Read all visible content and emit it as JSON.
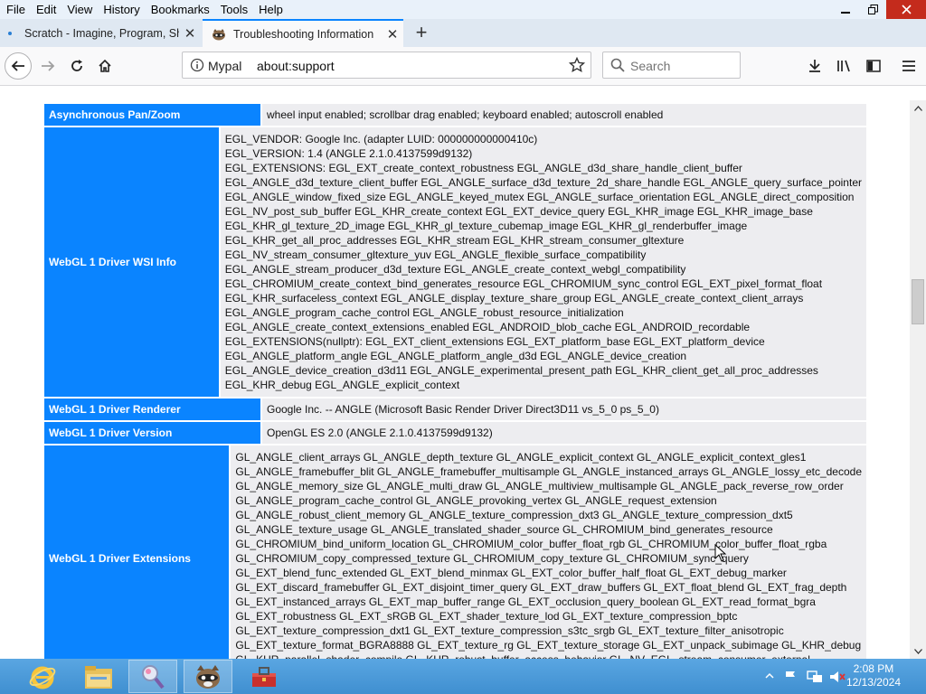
{
  "menu": [
    "File",
    "Edit",
    "View",
    "History",
    "Bookmarks",
    "Tools",
    "Help"
  ],
  "tabs": [
    {
      "label": "Scratch - Imagine, Program, Sh",
      "close": "✕"
    },
    {
      "label": "Troubleshooting Information",
      "close": "✕"
    }
  ],
  "new_tab": "+",
  "urlbar": {
    "identity": "Mypal",
    "url": "about:support"
  },
  "search": {
    "placeholder": "Search"
  },
  "rows": [
    {
      "key": "Asynchronous Pan/Zoom",
      "lines": [
        "wheel input enabled; scrollbar drag enabled; keyboard enabled; autoscroll enabled"
      ]
    },
    {
      "key": "WebGL 1 Driver WSI Info",
      "lines": [
        "EGL_VENDOR: Google Inc. (adapter LUID: 000000000000410c)",
        "EGL_VERSION: 1.4 (ANGLE 2.1.0.4137599d9132)",
        "EGL_EXTENSIONS: EGL_EXT_create_context_robustness EGL_ANGLE_d3d_share_handle_client_buffer",
        "EGL_ANGLE_d3d_texture_client_buffer EGL_ANGLE_surface_d3d_texture_2d_share_handle EGL_ANGLE_query_surface_pointer",
        "EGL_ANGLE_window_fixed_size EGL_ANGLE_keyed_mutex EGL_ANGLE_surface_orientation EGL_ANGLE_direct_composition",
        "EGL_NV_post_sub_buffer EGL_KHR_create_context EGL_EXT_device_query EGL_KHR_image EGL_KHR_image_base",
        "EGL_KHR_gl_texture_2D_image EGL_KHR_gl_texture_cubemap_image EGL_KHR_gl_renderbuffer_image",
        "EGL_KHR_get_all_proc_addresses EGL_KHR_stream EGL_KHR_stream_consumer_gltexture",
        "EGL_NV_stream_consumer_gltexture_yuv EGL_ANGLE_flexible_surface_compatibility",
        "EGL_ANGLE_stream_producer_d3d_texture EGL_ANGLE_create_context_webgl_compatibility",
        "EGL_CHROMIUM_create_context_bind_generates_resource EGL_CHROMIUM_sync_control EGL_EXT_pixel_format_float",
        "EGL_KHR_surfaceless_context EGL_ANGLE_display_texture_share_group EGL_ANGLE_create_context_client_arrays",
        "EGL_ANGLE_program_cache_control EGL_ANGLE_robust_resource_initialization",
        "EGL_ANGLE_create_context_extensions_enabled EGL_ANDROID_blob_cache EGL_ANDROID_recordable",
        "EGL_EXTENSIONS(nullptr): EGL_EXT_client_extensions EGL_EXT_platform_base EGL_EXT_platform_device",
        "EGL_ANGLE_platform_angle EGL_ANGLE_platform_angle_d3d EGL_ANGLE_device_creation",
        "EGL_ANGLE_device_creation_d3d11 EGL_ANGLE_experimental_present_path EGL_KHR_client_get_all_proc_addresses",
        "EGL_KHR_debug EGL_ANGLE_explicit_context"
      ]
    },
    {
      "key": "WebGL 1 Driver Renderer",
      "lines": [
        "Google Inc. -- ANGLE (Microsoft Basic Render Driver Direct3D11 vs_5_0 ps_5_0)"
      ]
    },
    {
      "key": "WebGL 1 Driver Version",
      "lines": [
        "OpenGL ES 2.0 (ANGLE 2.1.0.4137599d9132)"
      ]
    },
    {
      "key": "WebGL 1 Driver Extensions",
      "lines": [
        "GL_ANGLE_client_arrays GL_ANGLE_depth_texture GL_ANGLE_explicit_context GL_ANGLE_explicit_context_gles1",
        "GL_ANGLE_framebuffer_blit GL_ANGLE_framebuffer_multisample GL_ANGLE_instanced_arrays GL_ANGLE_lossy_etc_decode",
        "GL_ANGLE_memory_size GL_ANGLE_multi_draw GL_ANGLE_multiview_multisample GL_ANGLE_pack_reverse_row_order",
        "GL_ANGLE_program_cache_control GL_ANGLE_provoking_vertex GL_ANGLE_request_extension",
        "GL_ANGLE_robust_client_memory GL_ANGLE_texture_compression_dxt3 GL_ANGLE_texture_compression_dxt5",
        "GL_ANGLE_texture_usage GL_ANGLE_translated_shader_source GL_CHROMIUM_bind_generates_resource",
        "GL_CHROMIUM_bind_uniform_location GL_CHROMIUM_color_buffer_float_rgb GL_CHROMIUM_color_buffer_float_rgba",
        "GL_CHROMIUM_copy_compressed_texture GL_CHROMIUM_copy_texture GL_CHROMIUM_sync_query",
        "GL_EXT_blend_func_extended GL_EXT_blend_minmax GL_EXT_color_buffer_half_float GL_EXT_debug_marker",
        "GL_EXT_discard_framebuffer GL_EXT_disjoint_timer_query GL_EXT_draw_buffers GL_EXT_float_blend GL_EXT_frag_depth",
        "GL_EXT_instanced_arrays GL_EXT_map_buffer_range GL_EXT_occlusion_query_boolean GL_EXT_read_format_bgra",
        "GL_EXT_robustness GL_EXT_sRGB GL_EXT_shader_texture_lod GL_EXT_texture_compression_bptc",
        "GL_EXT_texture_compression_dxt1 GL_EXT_texture_compression_s3tc_srgb GL_EXT_texture_filter_anisotropic",
        "GL_EXT_texture_format_BGRA8888 GL_EXT_texture_rg GL_EXT_texture_storage GL_EXT_unpack_subimage GL_KHR_debug",
        "GL_KHR_parallel_shader_compile GL_KHR_robust_buffer_access_behavior GL_NV_EGL_stream_consumer_external"
      ]
    }
  ],
  "clock": {
    "time": "2:08 PM",
    "date": "12/13/2024"
  },
  "colors": {
    "accent": "#0a84ff",
    "taskbar": "#4a9ad8"
  }
}
